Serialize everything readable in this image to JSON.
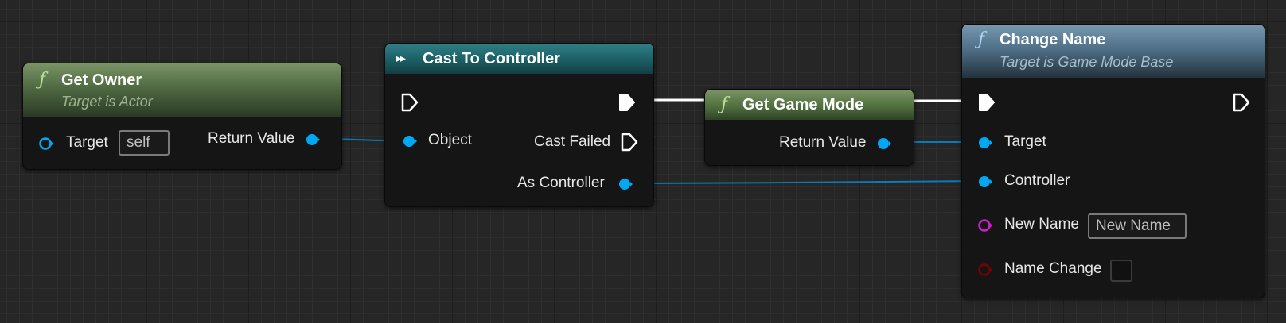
{
  "colors": {
    "grid_background": "#262626",
    "exec_pin": "#ffffff",
    "object_pin": "#00a8f4",
    "string_pin": "#d31ad3",
    "bool_pin": "#7a0000",
    "data_wire": "#0a7ab8",
    "exec_wire": "#ffffff"
  },
  "nodes": {
    "get_owner": {
      "icon": "function-icon",
      "glyph": "ƒ",
      "title": "Get Owner",
      "subtitle": "Target is Actor",
      "target_label": "Target",
      "target_value": "self",
      "return_label": "Return Value"
    },
    "cast_to_controller": {
      "icon": "cast-icon",
      "glyph": "▸▸",
      "title": "Cast To Controller",
      "object_label": "Object",
      "cast_failed_label": "Cast Failed",
      "as_controller_label": "As Controller"
    },
    "get_game_mode": {
      "icon": "function-icon",
      "glyph": "ƒ",
      "title": "Get Game Mode",
      "return_label": "Return Value"
    },
    "change_name": {
      "icon": "function-icon",
      "glyph": "ƒ",
      "title": "Change Name",
      "subtitle": "Target is Game Mode Base",
      "target_label": "Target",
      "controller_label": "Controller",
      "new_name_label": "New Name",
      "new_name_value": "New Name",
      "name_change_label": "Name Change",
      "name_change_checked": false
    }
  }
}
